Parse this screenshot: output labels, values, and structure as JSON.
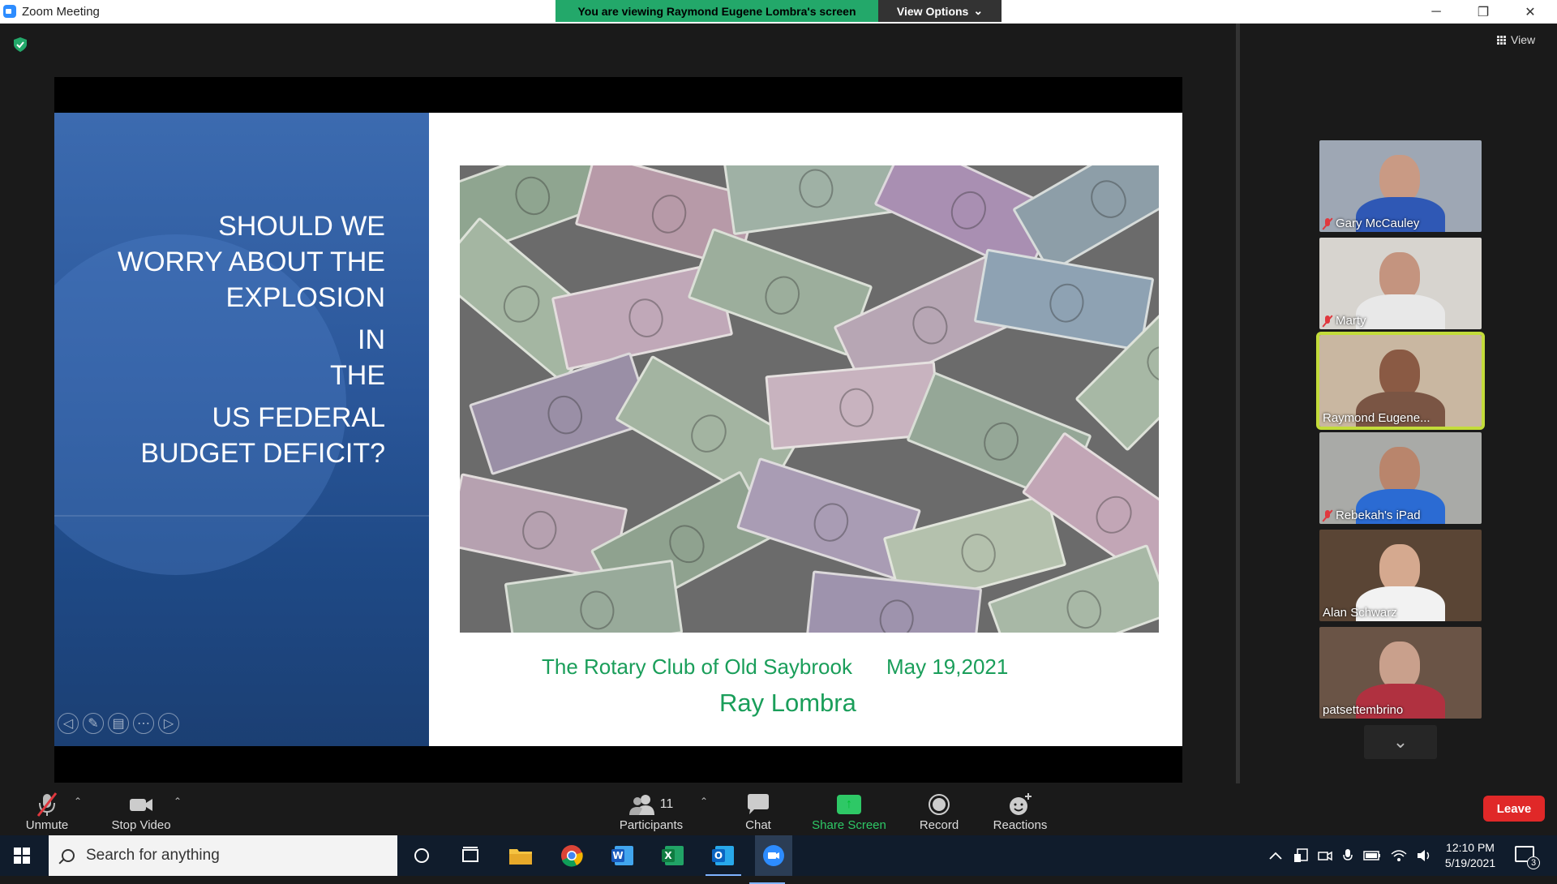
{
  "window": {
    "title": "Zoom Meeting",
    "minimize_icon": "─",
    "restore_icon": "❐",
    "close_icon": "✕"
  },
  "banner": {
    "viewing_text": "You are viewing Raymond Eugene Lombra's screen",
    "view_options_label": "View Options",
    "chevron": "⌄"
  },
  "header": {
    "view_label": "View"
  },
  "slide": {
    "title_lines": [
      "SHOULD WE",
      "WORRY ABOUT THE",
      "EXPLOSION",
      "IN",
      "THE",
      "US FEDERAL",
      "BUDGET DEFICIT?"
    ],
    "organization": "The Rotary Club of Old Saybrook",
    "date": "May 19,2021",
    "presenter": "Ray Lombra",
    "controls": [
      "◁",
      "✎",
      "▤",
      "⋯",
      "▷"
    ]
  },
  "participants": [
    {
      "name": "Gary McCauley",
      "muted": true,
      "bg": "#9ea7b4",
      "skin": "#c99a84",
      "shirt": "#2f58b5"
    },
    {
      "name": "Marty",
      "muted": true,
      "bg": "#d7d4cf",
      "skin": "#c4947f",
      "shirt": "#e8e8e8"
    },
    {
      "name": "Raymond Eugene...",
      "muted": false,
      "bg": "#c9b7a1",
      "skin": "#8a5a44",
      "shirt": "#7a5544"
    },
    {
      "name": "Rebekah's iPad",
      "muted": true,
      "bg": "#a9aaa7",
      "skin": "#b9856c",
      "shirt": "#2b6bd3"
    },
    {
      "name": "Alan Schwarz",
      "muted": false,
      "bg": "#5a4535",
      "skin": "#d5a98f",
      "shirt": "#f2f2f2"
    },
    {
      "name": "patsettembrino",
      "muted": false,
      "bg": "#6a5446",
      "skin": "#c9a08c",
      "shirt": "#b03140"
    }
  ],
  "gallery": {
    "more_icon": "⌄"
  },
  "toolbar": {
    "unmute_label": "Unmute",
    "stop_video_label": "Stop Video",
    "participants_label": "Participants",
    "participants_count": "11",
    "chat_label": "Chat",
    "share_screen_label": "Share Screen",
    "record_label": "Record",
    "reactions_label": "Reactions",
    "leave_label": "Leave",
    "caret": "⌃"
  },
  "taskbar": {
    "search_placeholder": "Search for anything",
    "time": "12:10 PM",
    "date": "5/19/2021",
    "notification_count": "3"
  },
  "colors": {
    "accent_green": "#23a86a",
    "leave_red": "#e02828",
    "active_speaker": "#c3dc3a",
    "slide_text_green": "#1a9e5a"
  }
}
